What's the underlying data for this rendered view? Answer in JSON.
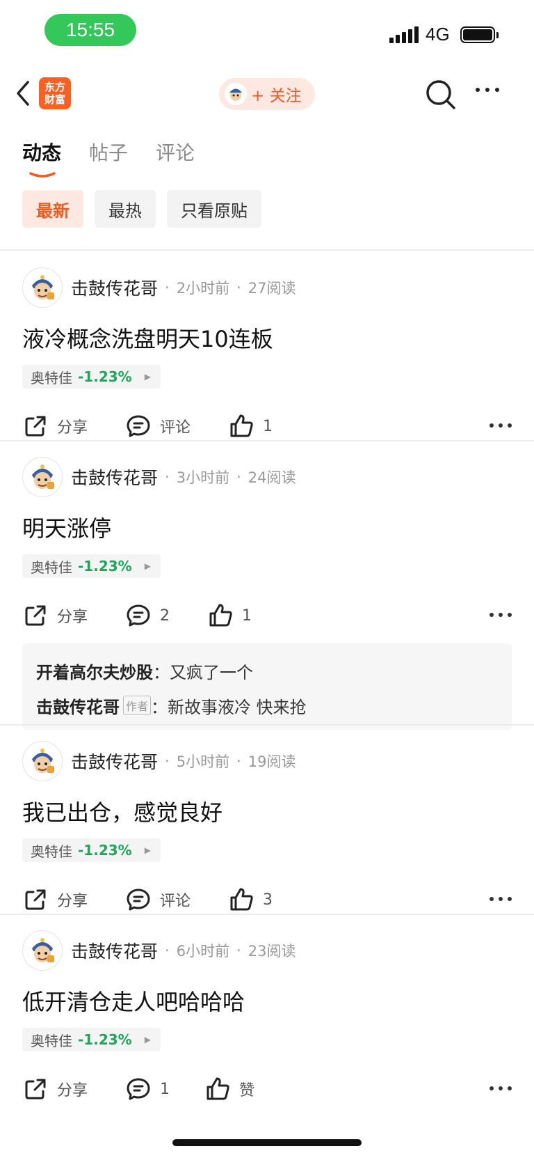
{
  "status_bar": {
    "time": "15:55",
    "network": "4G"
  },
  "nav": {
    "logo_line1": "东方",
    "logo_line2": "财富",
    "follow_label": "+ 关注"
  },
  "tabs": [
    {
      "label": "动态"
    },
    {
      "label": "帖子"
    },
    {
      "label": "评论"
    }
  ],
  "filters": [
    {
      "label": "最新"
    },
    {
      "label": "最热"
    },
    {
      "label": "只看原贴"
    }
  ],
  "posts": [
    {
      "author": "击鼓传花哥",
      "time": "2小时前",
      "reads": "27阅读",
      "title": "液冷概念洗盘明天10连板",
      "stock": {
        "name": "奥特佳",
        "change": "-1.23%"
      },
      "share_label": "分享",
      "comment_label": "评论",
      "like_label": "1"
    },
    {
      "author": "击鼓传花哥",
      "time": "3小时前",
      "reads": "24阅读",
      "title": "明天涨停",
      "stock": {
        "name": "奥特佳",
        "change": "-1.23%"
      },
      "share_label": "分享",
      "comment_label": "2",
      "like_label": "1",
      "comments": [
        {
          "author": "开着高尔夫炒股",
          "sep": "：",
          "text": "又疯了一个"
        },
        {
          "author": "击鼓传花哥",
          "badge": "作者",
          "sep": "：",
          "text": "新故事液冷 快来抢"
        }
      ]
    },
    {
      "author": "击鼓传花哥",
      "time": "5小时前",
      "reads": "19阅读",
      "title": "我已出仓，感觉良好",
      "stock": {
        "name": "奥特佳",
        "change": "-1.23%"
      },
      "share_label": "分享",
      "comment_label": "评论",
      "like_label": "3"
    },
    {
      "author": "击鼓传花哥",
      "time": "6小时前",
      "reads": "23阅读",
      "title": "低开清仓走人吧哈哈哈",
      "stock": {
        "name": "奥特佳",
        "change": "-1.23%"
      },
      "share_label": "分享",
      "comment_label": "1",
      "like_label": "赞"
    }
  ],
  "meta_separator": "·",
  "colors": {
    "accent": "#f25a1f",
    "fall": "#1aa85a",
    "status_green": "#34c759"
  }
}
